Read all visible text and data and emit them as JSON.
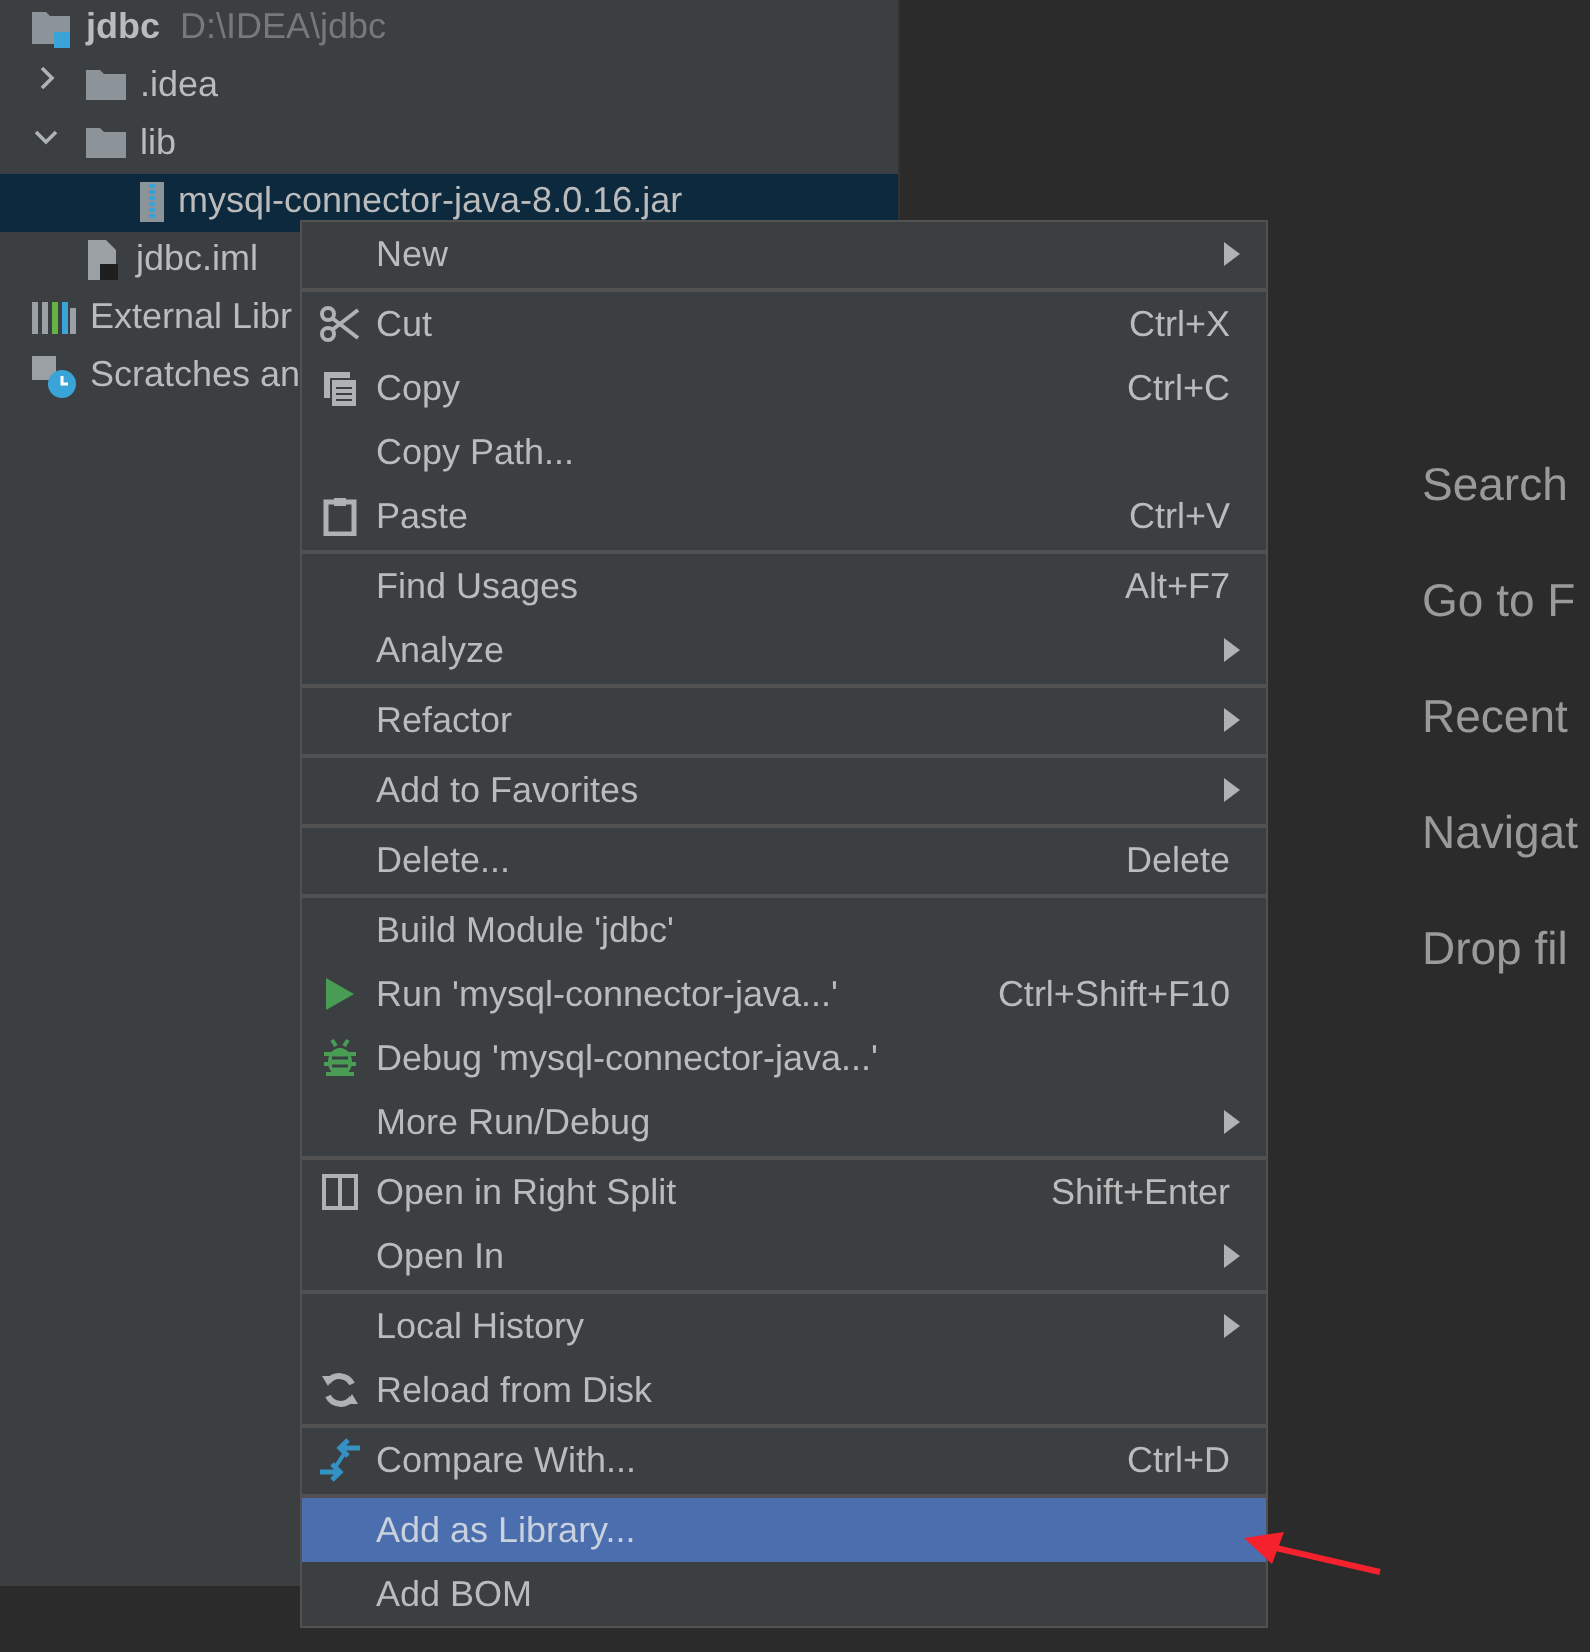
{
  "project_tree": [
    {
      "label": "jdbc",
      "path": "D:\\IDEA\\jdbc",
      "kind": "project",
      "selected": false,
      "children": [
        {
          "label": ".idea",
          "kind": "folder",
          "expanded": false,
          "selected": false
        },
        {
          "label": "lib",
          "kind": "folder",
          "expanded": true,
          "selected": false,
          "children": [
            {
              "label": "mysql-connector-java-8.0.16.jar",
              "kind": "jar",
              "selected": true
            }
          ]
        },
        {
          "label": "jdbc.iml",
          "kind": "iml",
          "selected": false
        }
      ]
    },
    {
      "label": "External Libr",
      "kind": "libraries",
      "selected": false
    },
    {
      "label": "Scratches an",
      "kind": "scratches",
      "selected": false
    }
  ],
  "context_menu": [
    [
      {
        "label": "New",
        "submenu": true,
        "selected": false
      }
    ],
    [
      {
        "label": "Cut",
        "kind": "cut",
        "shortcut": "Ctrl+X",
        "selected": false
      },
      {
        "label": "Copy",
        "kind": "copy",
        "shortcut": "Ctrl+C",
        "selected": false
      },
      {
        "label": "Copy Path...",
        "selected": false
      },
      {
        "label": "Paste",
        "kind": "paste",
        "shortcut": "Ctrl+V",
        "selected": false
      }
    ],
    [
      {
        "label": "Find Usages",
        "shortcut": "Alt+F7",
        "selected": false
      },
      {
        "label": "Analyze",
        "submenu": true,
        "selected": false
      }
    ],
    [
      {
        "label": "Refactor",
        "submenu": true,
        "selected": false
      }
    ],
    [
      {
        "label": "Add to Favorites",
        "submenu": true,
        "selected": false
      }
    ],
    [
      {
        "label": "Delete...",
        "shortcut": "Delete",
        "selected": false
      }
    ],
    [
      {
        "label": "Build Module 'jdbc'",
        "selected": false
      },
      {
        "label": "Run 'mysql-connector-java...'",
        "kind": "run",
        "shortcut": "Ctrl+Shift+F10",
        "selected": false
      },
      {
        "label": "Debug 'mysql-connector-java...'",
        "kind": "debug",
        "selected": false
      },
      {
        "label": "More Run/Debug",
        "submenu": true,
        "selected": false
      }
    ],
    [
      {
        "label": "Open in Right Split",
        "kind": "split",
        "shortcut": "Shift+Enter",
        "selected": false
      },
      {
        "label": "Open In",
        "submenu": true,
        "selected": false
      }
    ],
    [
      {
        "label": "Local History",
        "submenu": true,
        "selected": false
      },
      {
        "label": "Reload from Disk",
        "kind": "reload",
        "selected": false
      }
    ],
    [
      {
        "label": "Compare With...",
        "kind": "compare",
        "shortcut": "Ctrl+D",
        "selected": false
      }
    ],
    [
      {
        "label": "Add as Library...",
        "selected": true
      },
      {
        "label": "Add BOM",
        "selected": false
      }
    ]
  ],
  "editor_hints": [
    "Search",
    "Go to F",
    "Recent",
    "Navigat",
    "Drop fil"
  ]
}
